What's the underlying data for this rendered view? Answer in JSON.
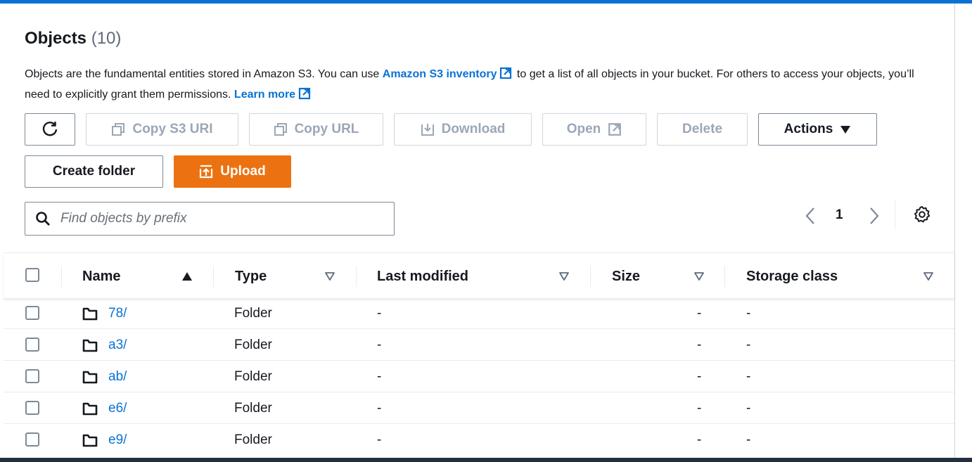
{
  "colors": {
    "accent": "#0972d3",
    "primary": "#ec7211",
    "text": "#16191f",
    "disabled": "#9ba7b6"
  },
  "header": {
    "title": "Objects",
    "count": "(10)"
  },
  "description": {
    "part1": "Objects are the fundamental entities stored in Amazon S3. You can use ",
    "inventory_link": "Amazon S3 inventory",
    "part2": " to get a list of all objects in your bucket. For others to access your objects, you’ll need to explicitly grant them permissions. ",
    "learn_more": "Learn more"
  },
  "toolbar": {
    "refresh_icon": "refresh-icon",
    "copy_s3_uri": "Copy S3 URI",
    "copy_url": "Copy URL",
    "download": "Download",
    "open": "Open",
    "delete": "Delete",
    "actions": "Actions",
    "create_folder": "Create folder",
    "upload": "Upload"
  },
  "search": {
    "placeholder": "Find objects by prefix",
    "value": ""
  },
  "pagination": {
    "current_page": "1"
  },
  "table": {
    "columns": {
      "name": "Name",
      "type": "Type",
      "last_modified": "Last modified",
      "size": "Size",
      "storage_class": "Storage class"
    },
    "rows": [
      {
        "name": "78/",
        "type": "Folder",
        "last_modified": "-",
        "size": "-",
        "storage_class": "-"
      },
      {
        "name": "a3/",
        "type": "Folder",
        "last_modified": "-",
        "size": "-",
        "storage_class": "-"
      },
      {
        "name": "ab/",
        "type": "Folder",
        "last_modified": "-",
        "size": "-",
        "storage_class": "-"
      },
      {
        "name": "e6/",
        "type": "Folder",
        "last_modified": "-",
        "size": "-",
        "storage_class": "-"
      },
      {
        "name": "e9/",
        "type": "Folder",
        "last_modified": "-",
        "size": "-",
        "storage_class": "-"
      }
    ]
  }
}
